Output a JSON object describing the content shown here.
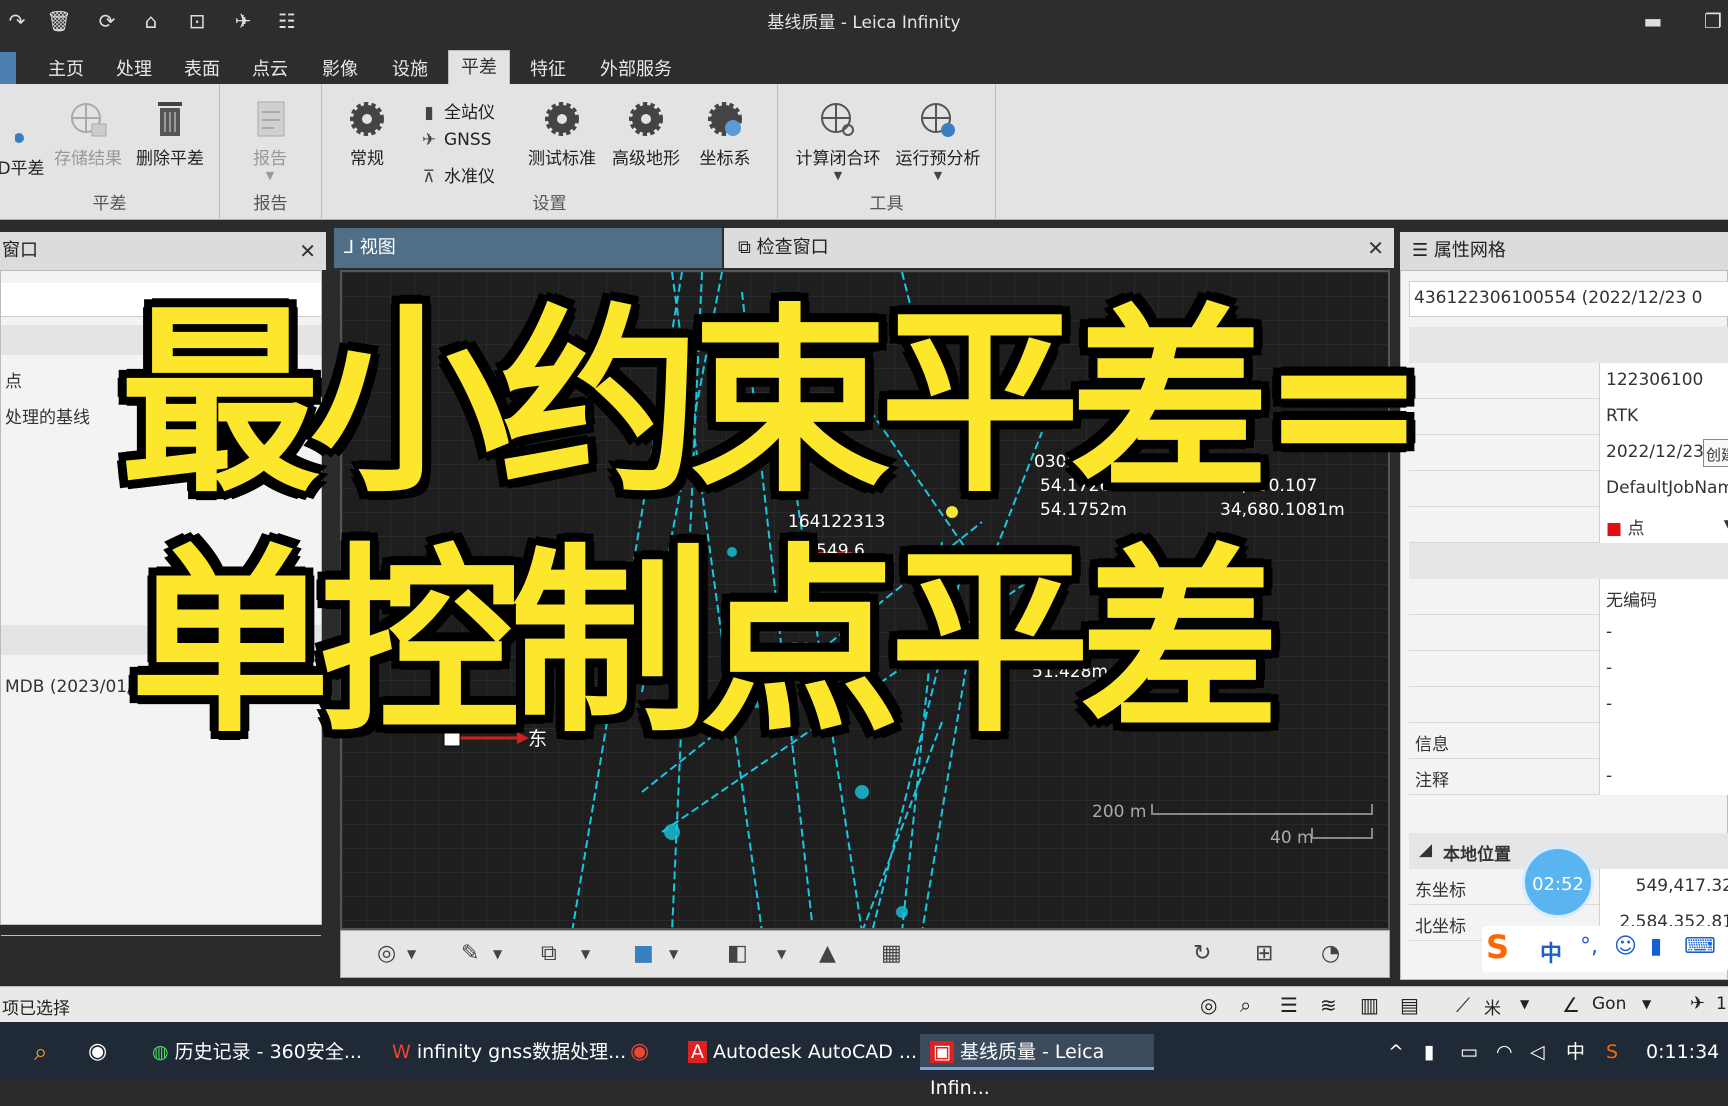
{
  "window": {
    "title": "基线质量 - Leica Infinity"
  },
  "ribbon_tabs": [
    "主页",
    "处理",
    "表面",
    "点云",
    "影像",
    "设施",
    "平差",
    "特征",
    "外部服务"
  ],
  "active_tab": "平差",
  "ribbon": {
    "adjust_group": {
      "label": "平差",
      "btn_adjust": "D平差",
      "btn_store": "存储结果",
      "btn_delete": "删除平差"
    },
    "report_group": {
      "label": "报告",
      "btn_report": "报告"
    },
    "settings_group": {
      "label": "设置",
      "btn_general": "常规",
      "total_station": "全站仪",
      "gnss": "GNSS",
      "level": "水准仪",
      "btn_test": "测试标准",
      "btn_terrain": "高级地形",
      "btn_coord": "坐标系"
    },
    "tools_group": {
      "label": "工具",
      "btn_loop": "计算闭合环",
      "btn_preanalysis": "运行预分析"
    }
  },
  "left_pane": {
    "title": "窗口",
    "items": [
      "点",
      "处理的基线"
    ],
    "bottom_item": "MDB (2023/01/2"
  },
  "view_tabs": {
    "view": "视图",
    "inspect": "检查窗口"
  },
  "viewport": {
    "labels": [
      "0305002749",
      "54.1726m",
      "34,680.107",
      "34,680.1081m",
      "54.1752m",
      "164122313",
      "东: 549,6",
      "51.428m",
      "31",
      "54"
    ],
    "axis_east": "东",
    "scale_200": "200 m",
    "scale_40": "40 m"
  },
  "right_pane": {
    "title": "属性网格",
    "header_value": "436122306100554 (2022/12/23 0",
    "rows": [
      {
        "key": "",
        "value": "122306100"
      },
      {
        "key": "",
        "value": "RTK"
      },
      {
        "key": "",
        "value": "2022/12/23"
      },
      {
        "key": "",
        "value": "DefaultJobNam"
      },
      {
        "key": "",
        "value": "点"
      },
      {
        "key": "",
        "value": "无编码"
      },
      {
        "key": "",
        "value": "-"
      },
      {
        "key": "",
        "value": "-"
      },
      {
        "key": "",
        "value": "-"
      },
      {
        "key": "信息",
        "value": ""
      },
      {
        "key": "注释",
        "value": "-"
      }
    ],
    "section_local": "本地位置",
    "east_label": "东坐标",
    "east_value": "549,417.32",
    "north_label": "北坐标",
    "north_value": "2,584,352.81",
    "create_btn": "创建"
  },
  "overlay": {
    "line1": "最小约束平差=",
    "line2": "单控制点平差"
  },
  "timer": "02:52",
  "status": {
    "left": "项已选择",
    "unit": "米",
    "angle": "Gon",
    "count": "1"
  },
  "ime": {
    "lang": "中"
  },
  "taskbar": {
    "items": [
      "历史记录 - 360安全...",
      "infinity gnss数据处理...",
      "Autodesk AutoCAD ...",
      "基线质量 - Leica Infin..."
    ],
    "lang": "中",
    "clock": "0:11:34"
  },
  "colors": {
    "overlay_yellow": "#fde72c",
    "view_tab": "#4f6e88",
    "network_cyan": "#18c7e0"
  }
}
